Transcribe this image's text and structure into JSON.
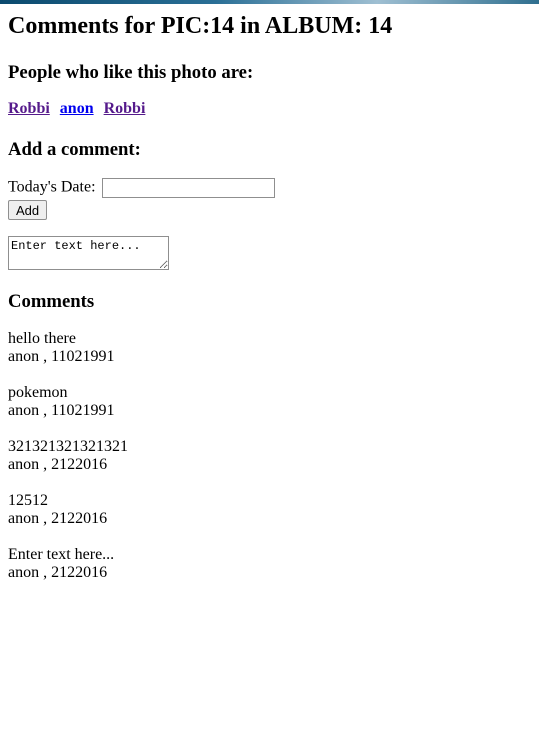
{
  "page": {
    "title": "Comments for PIC:14 in ALBUM: 14"
  },
  "likes": {
    "heading": "People who like this photo are:",
    "users": [
      "Robbi",
      "anon",
      "Robbi"
    ]
  },
  "add_comment": {
    "heading": "Add a comment:",
    "date_label": "Today's Date:",
    "date_value": "",
    "add_button": "Add",
    "text_placeholder": "Enter text here..."
  },
  "comments": {
    "heading": "Comments",
    "items": [
      {
        "text": "hello there",
        "meta": "anon , 11021991"
      },
      {
        "text": "pokemon",
        "meta": "anon , 11021991"
      },
      {
        "text": "321321321321321",
        "meta": "anon , 2122016"
      },
      {
        "text": "12512",
        "meta": "anon , 2122016"
      },
      {
        "text": "Enter text here...",
        "meta": "anon , 2122016"
      }
    ]
  }
}
